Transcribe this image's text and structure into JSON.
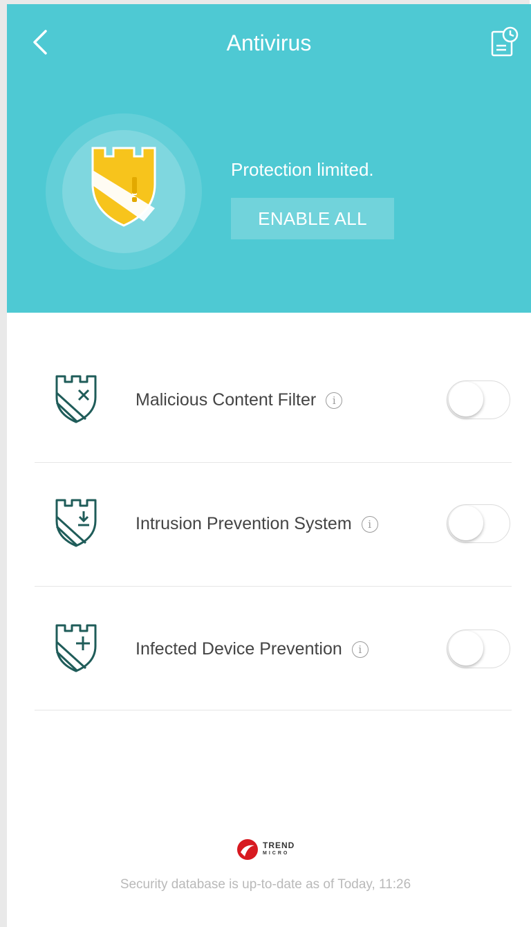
{
  "header": {
    "title": "Antivirus",
    "status": "Protection limited.",
    "enable_all_label": "ENABLE ALL",
    "shield_status_icon": "shield-warning-icon",
    "colors": {
      "header_bg": "#4ec9d3",
      "shield_fill": "#f7c41c"
    }
  },
  "features": [
    {
      "label": "Malicious Content Filter",
      "icon": "shield-x-icon",
      "enabled": false
    },
    {
      "label": "Intrusion Prevention System",
      "icon": "shield-download-icon",
      "enabled": false
    },
    {
      "label": "Infected Device Prevention",
      "icon": "shield-plus-icon",
      "enabled": false
    }
  ],
  "footer": {
    "logo_text": "TREND",
    "logo_subtext": "MICRO",
    "database_status": "Security database is up-to-date as of Today, 11:26"
  }
}
